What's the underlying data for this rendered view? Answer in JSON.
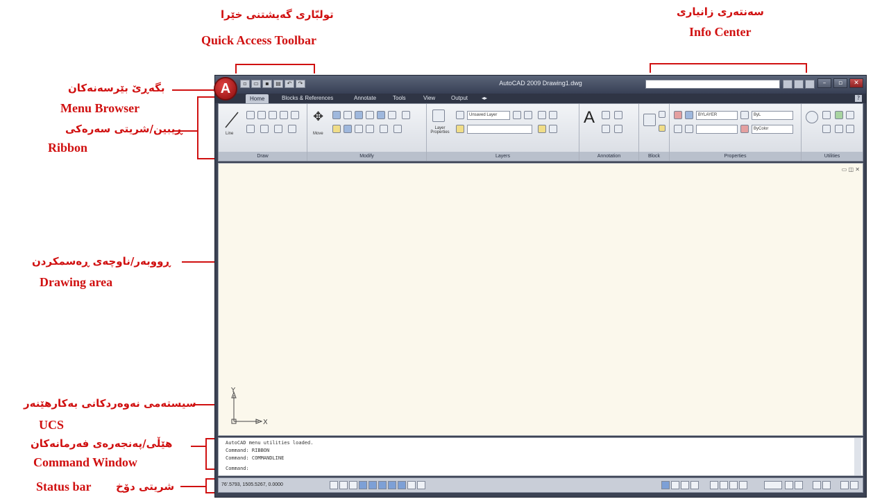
{
  "annotations": {
    "qat_kurdish": "تولبّاری گەیشتنی خێرا",
    "qat_title": "Quick Access Toolbar",
    "info_kurdish": "سەنتەری زانیاری",
    "info_title": "Info Center",
    "menu_kurdish": "بگەڕێ بێرسەنەکان",
    "menu_title": "Menu Browser",
    "ribbon_kurdish": "ڕیبین/شریتی سەرەکی",
    "ribbon_title": "Ribbon",
    "drawing_kurdish": "ڕووبەر/ناوچەی ڕەسمکردن",
    "drawing_title": "Drawing area",
    "ucs_kurdish": "سیستەمی نەوەردکانی بەکارهێنەر",
    "ucs_title": "UCS",
    "command_kurdish": "هێڵی/پەنجەرەی فەرمانەکان",
    "command_title": "Command Window",
    "status_kurdish": "شریتی دۆخ",
    "status_title": "Status bar"
  },
  "window": {
    "app_button": "A",
    "title": "AutoCAD 2009  Drawing1.dwg",
    "tabs": [
      "Home",
      "Blocks & References",
      "Annotate",
      "Tools",
      "View",
      "Output"
    ],
    "help": "?"
  },
  "ribbon": {
    "panels": [
      "Draw",
      "Modify",
      "Layers",
      "Annotation",
      "Block",
      "Properties",
      "Utilities"
    ],
    "line_label": "Line",
    "move_label": "Move",
    "layer_properties_label": "Layer Properties",
    "layer_dropdown": "Unsaved Layer",
    "color_dropdown": "BYLAYER",
    "lineweight_dropdown": "ByL",
    "bycolor_dropdown": "ByColor",
    "text_letter": "A"
  },
  "drawing": {
    "viewport_controls": "▭ ◫ ✕",
    "ucs_x": "X",
    "ucs_y": "Y"
  },
  "command_window": {
    "lines": [
      "AutoCAD menu utilities loaded.",
      "Command:  RIBBON",
      "Command:  COMMANDLINE",
      "Command:"
    ]
  },
  "status_bar": {
    "coords": "76'.5793, 1505.5267, 0.0000"
  },
  "colors": {
    "annotation": "#d01010",
    "window_frame": "#3c4354",
    "drawing_bg": "#fbf8ec"
  }
}
